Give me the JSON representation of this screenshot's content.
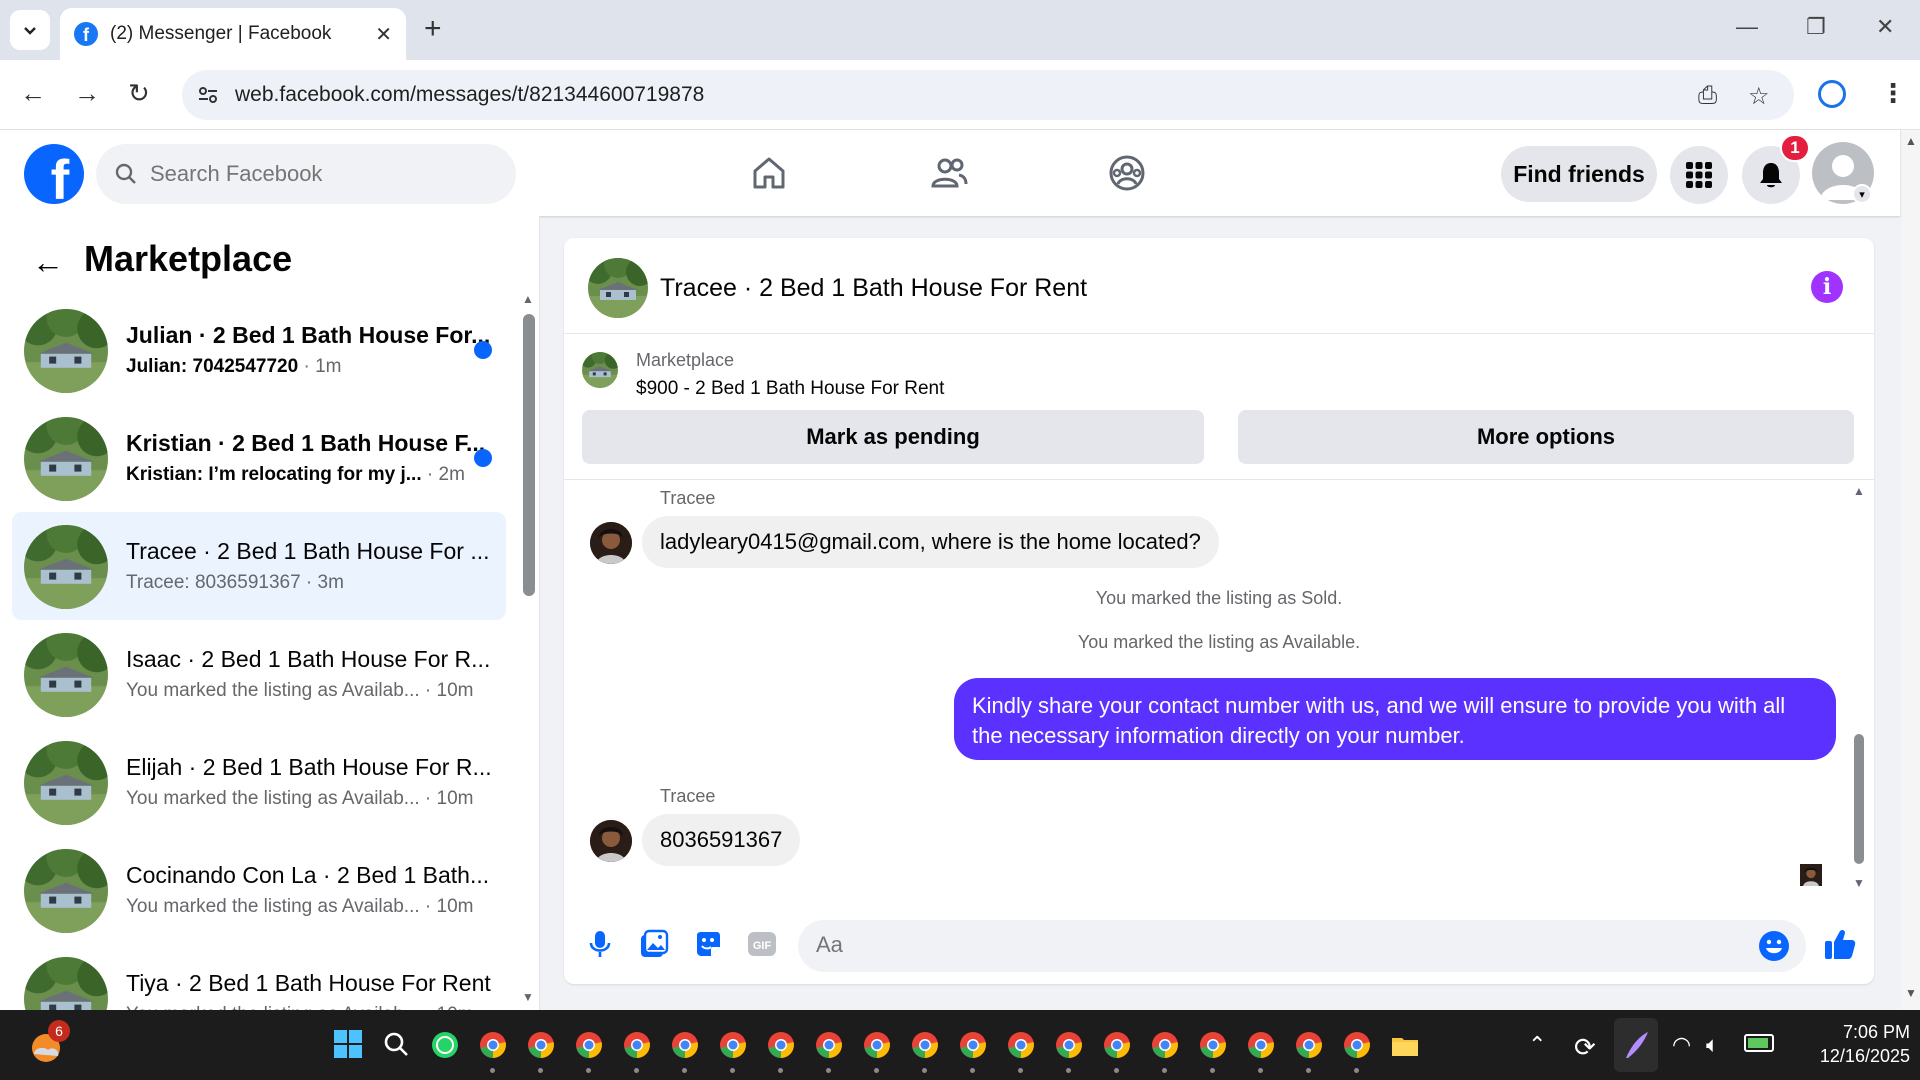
{
  "browser": {
    "tab_title": "(2) Messenger | Facebook",
    "url": "web.facebook.com/messages/t/821344600719878"
  },
  "header": {
    "search_placeholder": "Search Facebook",
    "find_friends_label": "Find friends",
    "notification_count": "1"
  },
  "sidebar": {
    "title": "Marketplace",
    "conversations": [
      {
        "name": "Julian · 2 Bed 1 Bath House For...",
        "preview": "Julian: 7042547720",
        "time": "1m",
        "unread": true
      },
      {
        "name": "Kristian · 2 Bed 1 Bath House F...",
        "preview": "Kristian: I’m relocating for my j...",
        "time": "2m",
        "unread": true
      },
      {
        "name": "Tracee · 2 Bed 1 Bath House For ...",
        "preview": "Tracee: 8036591367",
        "time": "3m",
        "unread": false,
        "active": true
      },
      {
        "name": "Isaac · 2 Bed 1 Bath House For R...",
        "preview": "You marked the listing as Availab...",
        "time": "10m",
        "unread": false
      },
      {
        "name": "Elijah · 2 Bed 1 Bath House For R...",
        "preview": "You marked the listing as Availab...",
        "time": "10m",
        "unread": false
      },
      {
        "name": "Cocinando Con La · 2 Bed 1 Bath...",
        "preview": "You marked the listing as Availab...",
        "time": "10m",
        "unread": false
      },
      {
        "name": "Tiya · 2 Bed 1 Bath House For Rent",
        "preview": "You marked the listing as Availab...",
        "time": "10m",
        "unread": false
      }
    ]
  },
  "chat": {
    "title": "Tracee · 2 Bed 1 Bath House For Rent",
    "listing_label": "Marketplace",
    "listing_price": "$900 - 2 Bed 1 Bath House For Rent",
    "mark_pending_label": "Mark as pending",
    "more_options_label": "More options",
    "messages": {
      "sender1": "Tracee",
      "msg1": "ladyleary0415@gmail.com, where is the home located?",
      "sys1": "You marked the listing as Sold.",
      "sys2": "You marked the listing as Available.",
      "outgoing": "Kindly share your contact number with us, and we will ensure to provide you with all the necessary information directly on your number.",
      "sender2": "Tracee",
      "msg2": "8036591367"
    },
    "composer_placeholder": "Aa",
    "accent_color": "#5b31ff"
  },
  "taskbar": {
    "weather_badge": "6",
    "time": "7:06 PM",
    "date": "12/16/2025"
  }
}
